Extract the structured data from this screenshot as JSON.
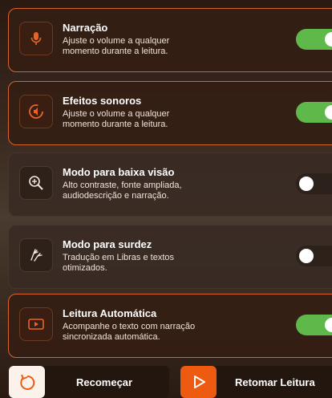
{
  "settings": [
    {
      "title": "Narração",
      "desc1": "Ajuste o volume a qualquer",
      "desc2": "momento durante a leitura.",
      "icon": "microphone-icon",
      "enabled": true
    },
    {
      "title": "Efeitos sonoros",
      "desc1": "Ajuste o volume a qualquer",
      "desc2": "momento durante a leitura.",
      "icon": "sound-effects-icon",
      "enabled": true
    },
    {
      "title": "Modo para baixa visão",
      "desc1": "Alto contraste, fonte ampliada,",
      "desc2": "audiodescrição e narração.",
      "icon": "magnifier-icon",
      "enabled": false
    },
    {
      "title": "Modo para surdez",
      "desc1": "Tradução em Libras e textos",
      "desc2": "otimizados.",
      "icon": "sign-language-hands-icon",
      "enabled": false
    },
    {
      "title": "Leitura Automática",
      "desc1": "Acompanhe o texto com narração",
      "desc2": "sincronizada automática.",
      "icon": "auto-read-icon",
      "enabled": true
    }
  ],
  "actions": {
    "restart_label": "Recomeçar",
    "resume_label": "Retomar Leitura"
  },
  "colors": {
    "accent": "#ee5a0f",
    "toggle_on": "#5fb84a",
    "toggle_off": "#2d211b"
  }
}
